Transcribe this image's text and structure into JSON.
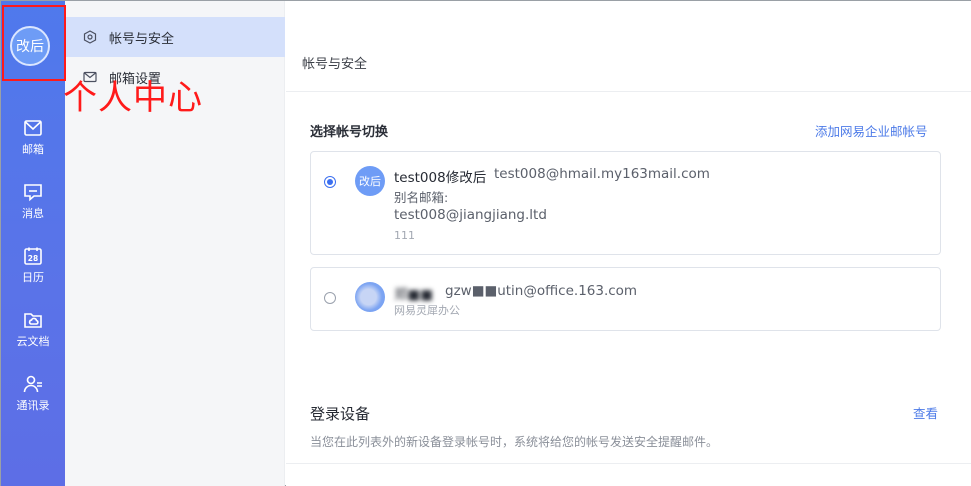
{
  "user": {
    "avatar_text": "改后"
  },
  "annotation": {
    "text": "个人中心"
  },
  "rail": {
    "items": [
      {
        "label": "邮箱",
        "icon": "mail-icon"
      },
      {
        "label": "消息",
        "icon": "message-icon"
      },
      {
        "label": "日历",
        "icon": "calendar-icon",
        "badge": "28"
      },
      {
        "label": "云文档",
        "icon": "cloud-doc-icon"
      },
      {
        "label": "通讯录",
        "icon": "contacts-icon"
      }
    ]
  },
  "menu": {
    "items": [
      {
        "label": "帐号与安全",
        "icon": "shield-icon",
        "active": true
      },
      {
        "label": "邮箱设置",
        "icon": "mail-icon",
        "active": false
      }
    ]
  },
  "main": {
    "title": "帐号与安全",
    "switch_section": {
      "title": "选择帐号切换",
      "add_link": "添加网易企业邮帐号",
      "accounts": [
        {
          "selected": true,
          "avatar_text": "改后",
          "name": "test008修改后",
          "email": "test008@hmail.my163mail.com",
          "alias_label": "别名邮箱:",
          "alias": "test008@jiangjiang.ltd",
          "extra": "111"
        },
        {
          "selected": false,
          "avatar_text": "",
          "name": "郑■■",
          "email": "gzw■■utin@office.163.com",
          "org": "网易灵犀办公"
        }
      ]
    },
    "login_section": {
      "title": "登录设备",
      "view_link": "查看",
      "description": "当您在此列表外的新设备登录帐号时，系统将给您的帐号发送安全提醒邮件。"
    }
  },
  "colors": {
    "rail": "#5a73e8",
    "accent": "#4d7be8",
    "active_menu": "#d4e0fb",
    "annotation": "#ff1a1a"
  }
}
